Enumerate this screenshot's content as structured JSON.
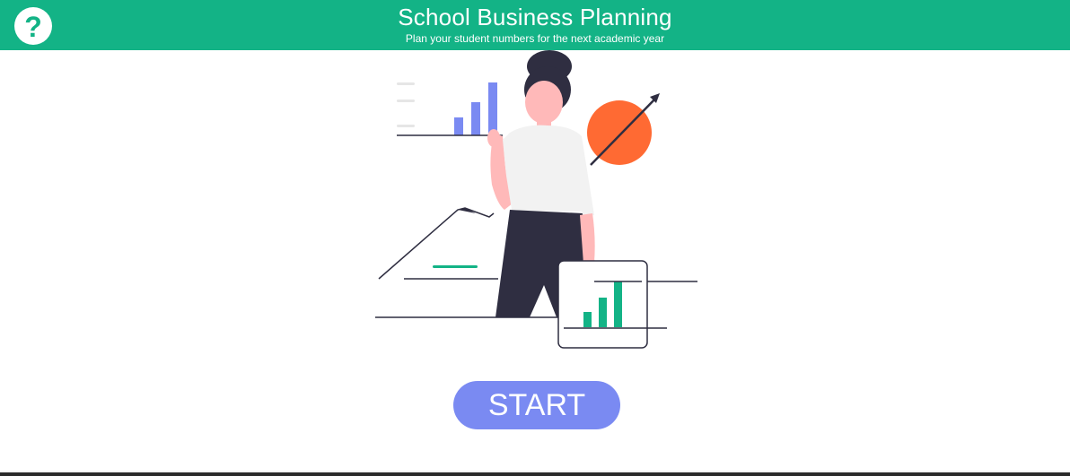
{
  "header": {
    "title": "School Business Planning",
    "subtitle": "Plan your student numbers for the next academic year",
    "help_icon": "question-mark-icon",
    "background": "#13b386"
  },
  "main": {
    "start_label": "START",
    "start_color": "#7a8af2",
    "illustration": "person-presenting-growth-charts"
  },
  "colors": {
    "accent_green": "#13b386",
    "bar_blue": "#7a8af2",
    "circle_orange": "#ff6a33",
    "dark": "#2f2e41",
    "skin": "#ffb9b9",
    "shirt": "#f2f2f2"
  }
}
